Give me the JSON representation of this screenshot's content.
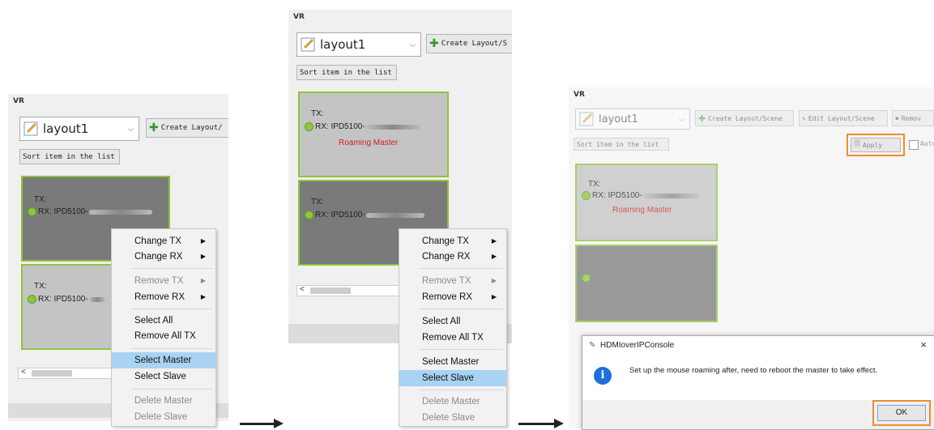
{
  "header_marker": "VR",
  "layout_name": "layout1",
  "create_layout_label": "Create Layout/S",
  "create_layout_label_short": "Create Layout/",
  "create_layout_scene_label": "Create Layout/Scene",
  "edit_layout_scene_label": "Edit Layout/Scene",
  "remove_label": "Remov",
  "sort_label": "Sort item in the list",
  "apply_label": "Apply",
  "auto_label": "Auto",
  "tile": {
    "tx_label": "TX:",
    "rx_label": "RX: IPD5100-",
    "roaming_master": "Roaming Master"
  },
  "menu": {
    "change_tx": "Change TX",
    "change_rx": "Change RX",
    "remove_tx": "Remove TX",
    "remove_rx": "Remove RX",
    "select_all": "Select All",
    "remove_all_tx": "Remove All TX",
    "select_master": "Select Master",
    "select_slave": "Select Slave",
    "delete_master": "Delete Master",
    "delete_slave": "Delete Slave"
  },
  "dialog": {
    "title": "HDMIoverIPConsole",
    "message": "Set up the mouse roaming after, need to reboot the master to take effect.",
    "ok_label": "OK",
    "close_glyph": "×"
  },
  "icons": {
    "submenu": "▶",
    "dropdown": "⌵",
    "scroll_left": "<",
    "info": "i"
  },
  "colors": {
    "tile_border": "#8fc43e",
    "master_text": "#d12020",
    "highlight": "#f08c2a",
    "menu_selected": "#a9d3f2"
  }
}
